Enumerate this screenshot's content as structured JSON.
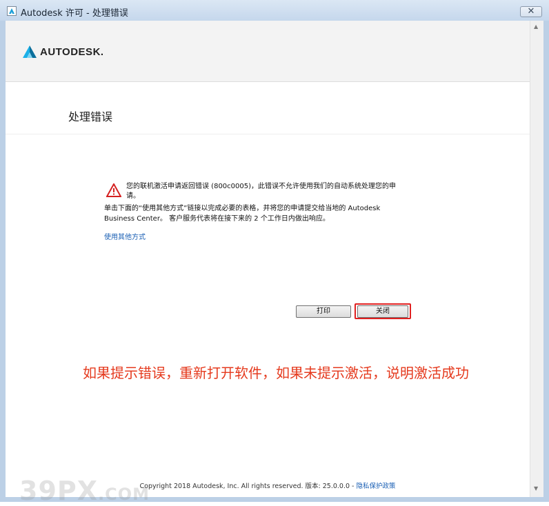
{
  "window": {
    "title": "Autodesk 许可 - 处理错误",
    "close_glyph": "✕"
  },
  "brand": {
    "logo_text": "AUTODESK.",
    "accent_color": "#1a9fd8"
  },
  "page": {
    "heading": "处理错误",
    "error_message_line1": "您的联机激活申请返回错误 (800c0005)，此错误不允许使用我们的自动系统处理您的申",
    "error_message_line2": "请。",
    "instruction_line1": "单击下面的“使用其他方式”链接以完成必要的表格，并将您的申请提交给当地的 Autodesk",
    "instruction_line2": "Business Center。 客户服务代表将在接下来的 2 个工作日内做出响应。",
    "alt_method_link": "使用其他方式",
    "print_button": "打印",
    "close_button": "关闭",
    "annotation": "如果提示错误，重新打开软件，如果未提示激活，说明激活成功",
    "annotation_color": "#e53a1e"
  },
  "footer": {
    "copyright": "Copyright 2018 Autodesk, Inc. All rights reserved. 版本: 25.0.0.0 - ",
    "privacy_link": "隐私保护政策"
  },
  "watermark": {
    "main": "39PX",
    "suffix": ".COM"
  }
}
